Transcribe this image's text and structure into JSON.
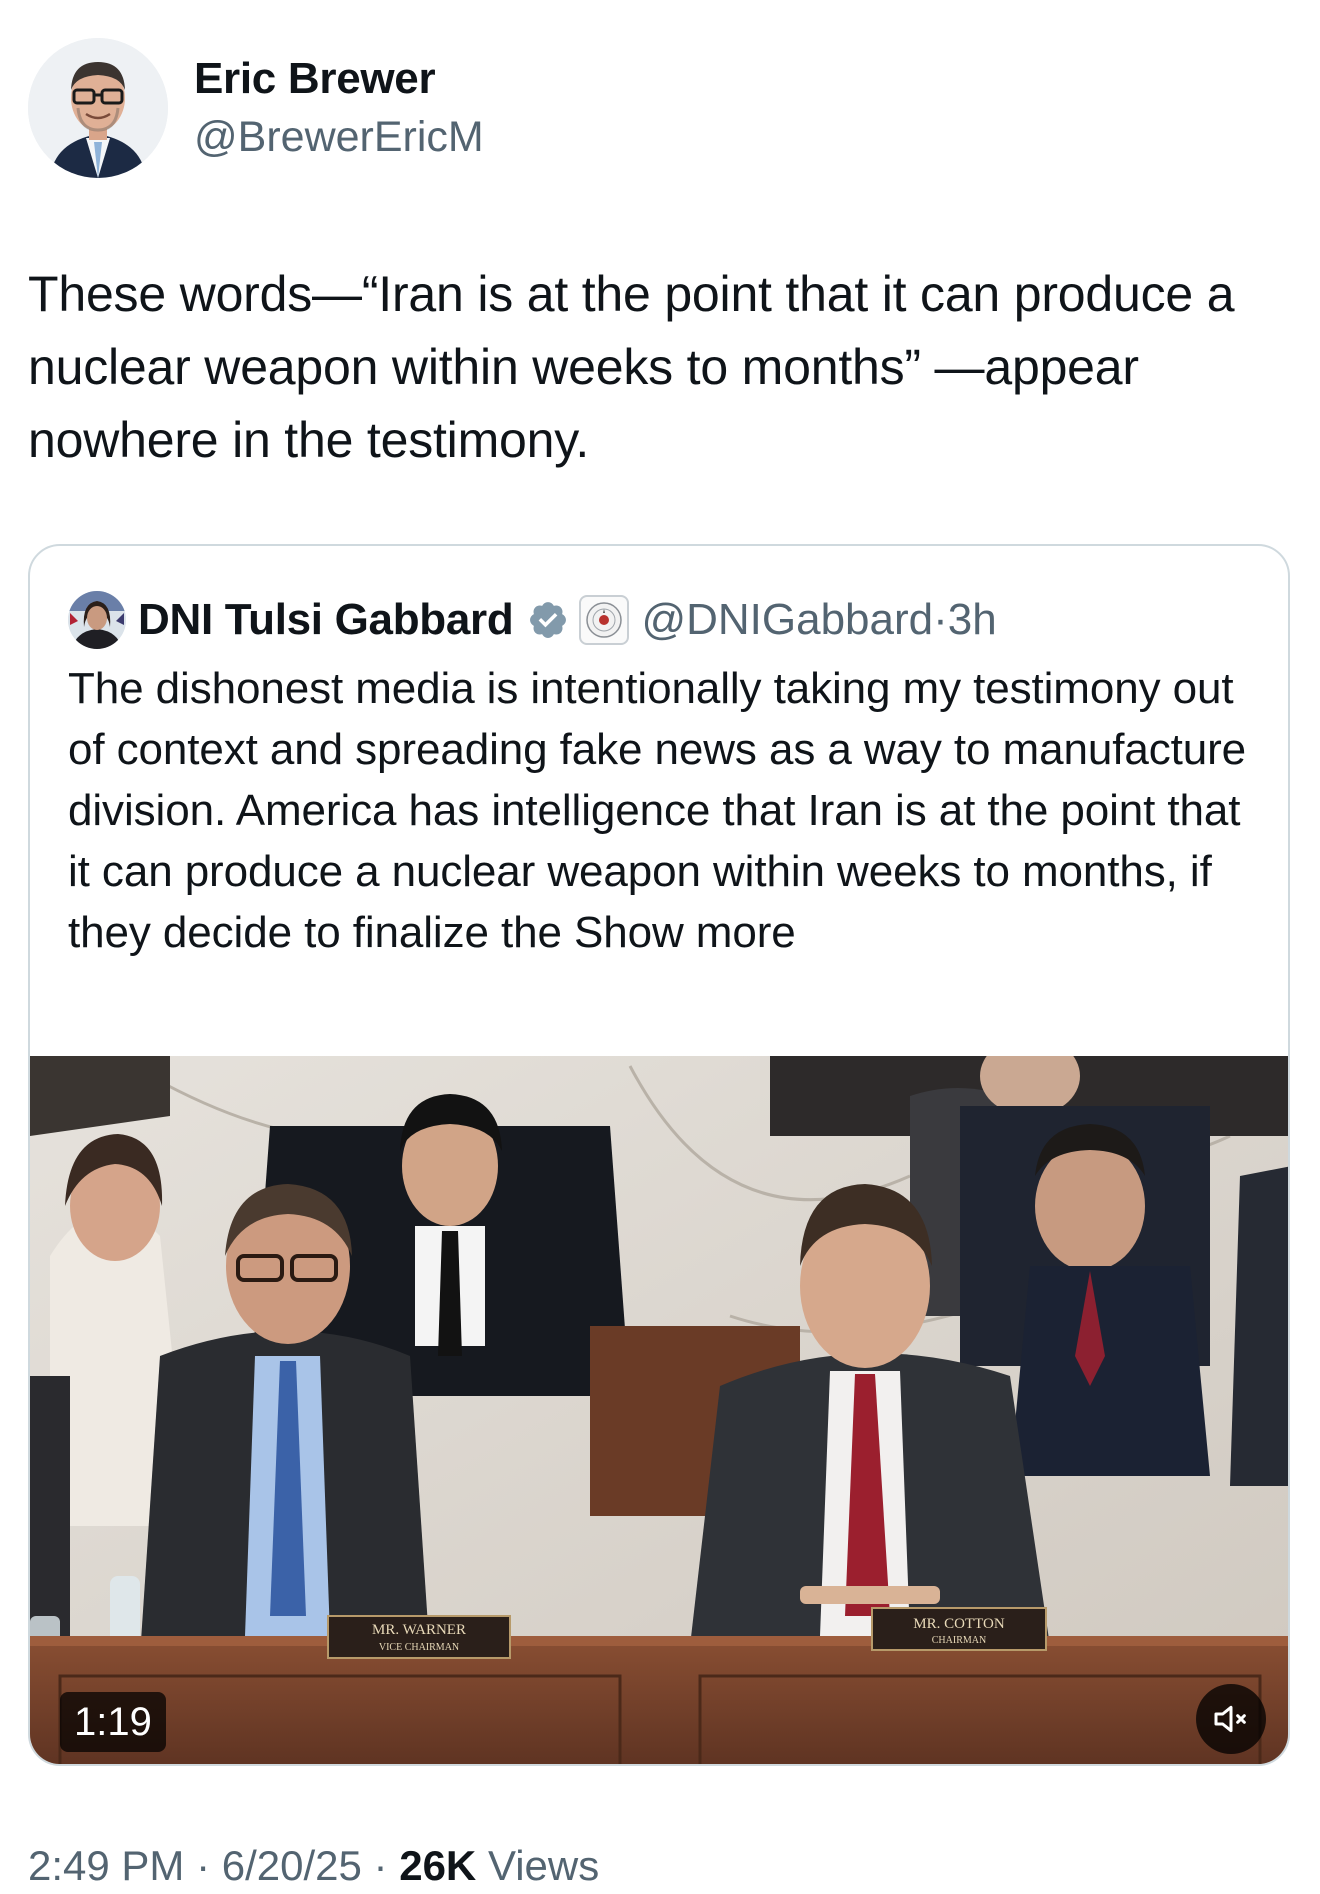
{
  "author": {
    "name": "Eric Brewer",
    "handle": "@BrewerEricM"
  },
  "tweet": {
    "text": "These words—“Iran is at the point that it can produce a nuclear weapon within weeks to months” —appear nowhere in the testimony."
  },
  "quote": {
    "name": "DNI Tulsi Gabbard",
    "handle": "@DNIGabbard",
    "separator": " · ",
    "time": "3h",
    "text": "The dishonest media is intentionally taking my testimony out of context and spreading fake news as a way to manufacture division. America has intelligence that Iran is at the point that it can produce a nuclear weapon within weeks to months, if they decide to finalize the ",
    "show_more": "Show more",
    "verified_icon": "verified-badge-icon",
    "video": {
      "duration": "1:19",
      "nameplate_left": "MR. WARNER",
      "nameplate_left_sub": "VICE CHAIRMAN",
      "nameplate_right": "MR. COTTON",
      "nameplate_right_sub": "CHAIRMAN"
    }
  },
  "meta": {
    "time": "2:49 PM",
    "sep1": " · ",
    "date": "6/20/25",
    "sep2": " · ",
    "views_count": "26K",
    "views_label": " Views"
  },
  "colors": {
    "text": "#0f1419",
    "secondary": "#536471",
    "border": "#cfd9de",
    "verified": "#829aab"
  }
}
